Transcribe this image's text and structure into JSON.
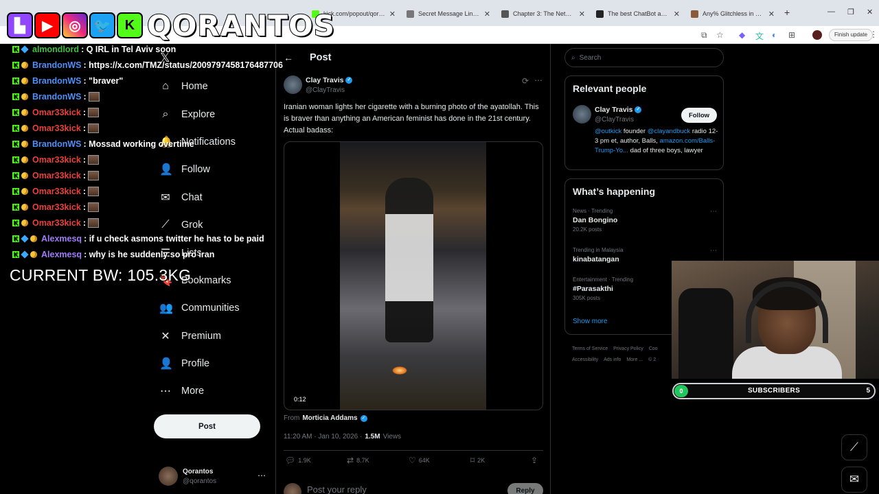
{
  "browser": {
    "tabs": [
      {
        "title": "kick.com/popout/qorantos",
        "favicon_color": "#53fc18"
      },
      {
        "title": "Secret Message Link 2026",
        "favicon_color": "#777777"
      },
      {
        "title": "Chapter 3: The Nether Pa",
        "favicon_color": "#555555"
      },
      {
        "title": "The best ChatBot and Wi",
        "favicon_color": "#222222"
      },
      {
        "title": "Any% Glitchless in 13:38.",
        "favicon_color": "#8a5a3a"
      }
    ],
    "new_tab": "+",
    "finish_update": "Finish update"
  },
  "overlay": {
    "logo_text": "QORANTOS",
    "social_icons": [
      "twitch-icon",
      "youtube-icon",
      "instagram-icon",
      "twitter-icon",
      "kick-icon"
    ],
    "chat": [
      {
        "user": "almondlord",
        "color": "#3fbf3f",
        "text": ": Q IRL in Tel Aviv soon",
        "badges": [
          "kick",
          "gem"
        ]
      },
      {
        "user": "BrandonWS",
        "color": "#4f8ff7",
        "text": ": https://x.com/TMZ/status/2009797458176487706",
        "badges": [
          "kick",
          "moon"
        ]
      },
      {
        "user": "BrandonWS",
        "color": "#4f8ff7",
        "text": ": \"braver\"",
        "badges": [
          "kick",
          "moon"
        ]
      },
      {
        "user": "BrandonWS",
        "color": "#4f8ff7",
        "text": ":",
        "badges": [
          "kick",
          "moon"
        ],
        "emote": true
      },
      {
        "user": "Omar33kick",
        "color": "#e8413c",
        "text": ":",
        "badges": [
          "kick",
          "moon"
        ],
        "emote": true
      },
      {
        "user": "Omar33kick",
        "color": "#e8413c",
        "text": ":",
        "badges": [
          "kick",
          "moon"
        ],
        "emote": true
      },
      {
        "user": "BrandonWS",
        "color": "#4f8ff7",
        "text": ": Mossad working overtime",
        "badges": [
          "kick",
          "moon"
        ]
      },
      {
        "user": "Omar33kick",
        "color": "#e8413c",
        "text": ":",
        "badges": [
          "kick",
          "moon"
        ],
        "emote": true
      },
      {
        "user": "Omar33kick",
        "color": "#e8413c",
        "text": ":",
        "badges": [
          "kick",
          "moon"
        ],
        "emote": true
      },
      {
        "user": "Omar33kick",
        "color": "#e8413c",
        "text": ":",
        "badges": [
          "kick",
          "moon"
        ],
        "emote": true
      },
      {
        "user": "Omar33kick",
        "color": "#e8413c",
        "text": ":",
        "badges": [
          "kick",
          "moon"
        ],
        "emote": true
      },
      {
        "user": "Omar33kick",
        "color": "#e8413c",
        "text": ":",
        "badges": [
          "kick",
          "moon"
        ],
        "emote": true
      },
      {
        "user": "Alexmesq",
        "color": "#a07cf7",
        "text": ": if u check asmons twitter he has to be paid",
        "badges": [
          "kick",
          "gem",
          "moon"
        ]
      },
      {
        "user": "Alexmesq",
        "color": "#a07cf7",
        "text": ": why is he suddenly so pro iran",
        "badges": [
          "kick",
          "gem",
          "moon"
        ]
      }
    ],
    "bw_label": "CURRENT BW: 105.3KG",
    "subscribers": {
      "label": "SUBSCRIBERS",
      "current": "0",
      "goal": "5",
      "accent": "#22c55e"
    }
  },
  "x_nav": {
    "items": [
      {
        "label": "Home",
        "icon": "home-icon",
        "glyph": "⌂"
      },
      {
        "label": "Explore",
        "icon": "search-icon",
        "glyph": "⌕"
      },
      {
        "label": "Notifications",
        "icon": "bell-icon",
        "glyph": "🔔"
      },
      {
        "label": "Follow",
        "icon": "person-add-icon",
        "glyph": "👤"
      },
      {
        "label": "Chat",
        "icon": "mail-icon",
        "glyph": "✉"
      },
      {
        "label": "Grok",
        "icon": "grok-icon",
        "glyph": "⟋"
      },
      {
        "label": "Lists",
        "icon": "list-icon",
        "glyph": "☰"
      },
      {
        "label": "Bookmarks",
        "icon": "bookmark-icon",
        "glyph": "🔖"
      },
      {
        "label": "Communities",
        "icon": "communities-icon",
        "glyph": "👥"
      },
      {
        "label": "Premium",
        "icon": "x-icon",
        "glyph": "✕"
      },
      {
        "label": "Profile",
        "icon": "profile-icon",
        "glyph": "👤"
      },
      {
        "label": "More",
        "icon": "more-icon",
        "glyph": "⋯"
      }
    ],
    "post_button": "Post",
    "account": {
      "name": "Qorantos",
      "handle": "@qorantos"
    }
  },
  "post": {
    "header": "Post",
    "author": {
      "name": "Clay Travis",
      "handle": "@ClayTravis"
    },
    "text": "Iranian woman lights her cigarette with a burning photo of the ayatollah. This is braver than anything an American feminist has done in the 21st century. Actual badass:",
    "video_time": "0:12",
    "from_label": "From",
    "from_name": "Morticia Addams",
    "time": "11:20 AM · Jan 10, 2026 ·",
    "views_count": "1.5M",
    "views_label": "Views",
    "actions": {
      "replies": "1.9K",
      "reposts": "8.7K",
      "likes": "64K",
      "bookmarks": "2K"
    },
    "reply_placeholder": "Post your reply",
    "reply_button": "Reply"
  },
  "right": {
    "search_placeholder": "Search",
    "relevant_title": "Relevant people",
    "relevant": {
      "name": "Clay Travis",
      "handle": "@ClayTravis",
      "follow": "Follow",
      "bio_parts": [
        "@outkick",
        " founder ",
        "@clayandbuck",
        " radio 12-3 pm et, author, Balls, ",
        "amazon.com/Balls-Trump-Yo...",
        " dad of three boys, lawyer"
      ]
    },
    "happening_title": "What’s happening",
    "trends": [
      {
        "category": "News · Trending",
        "name": "Dan Bongino",
        "count": "20.2K posts"
      },
      {
        "category": "Trending in Malaysia",
        "name": "kinabatangan",
        "count": ""
      },
      {
        "category": "Entertainment · Trending",
        "name": "#Parasakthi",
        "count": "305K posts"
      }
    ],
    "show_more": "Show more",
    "footer": [
      "Terms of Service",
      "Privacy Policy",
      "Coo",
      "Accessibility",
      "Ads info",
      "More ...",
      "© 2"
    ]
  }
}
